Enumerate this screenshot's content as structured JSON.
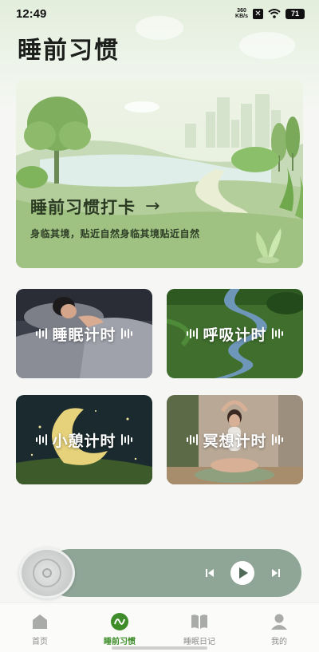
{
  "status_bar": {
    "time": "12:49",
    "net_speed_value": "360",
    "net_speed_unit": "KB/s",
    "battery": "71"
  },
  "page": {
    "title": "睡前习惯"
  },
  "hero": {
    "title": "睡前习惯打卡",
    "arrow": "→",
    "subtitle": "身临其境，贴近自然身临其境贴近自然"
  },
  "timers": [
    {
      "label": "睡眠计时"
    },
    {
      "label": "呼吸计时"
    },
    {
      "label": "小憩计时"
    },
    {
      "label": "冥想计时"
    }
  ],
  "player": {
    "prev_icon": "skip-previous-icon",
    "play_icon": "play-icon",
    "next_icon": "skip-next-icon"
  },
  "tabbar": {
    "active_color": "#3e8d2a",
    "items": [
      {
        "label": "首页",
        "icon": "home-icon"
      },
      {
        "label": "睡前习惯",
        "icon": "wave-icon"
      },
      {
        "label": "睡眠日记",
        "icon": "book-icon"
      },
      {
        "label": "我的",
        "icon": "user-icon"
      }
    ]
  }
}
